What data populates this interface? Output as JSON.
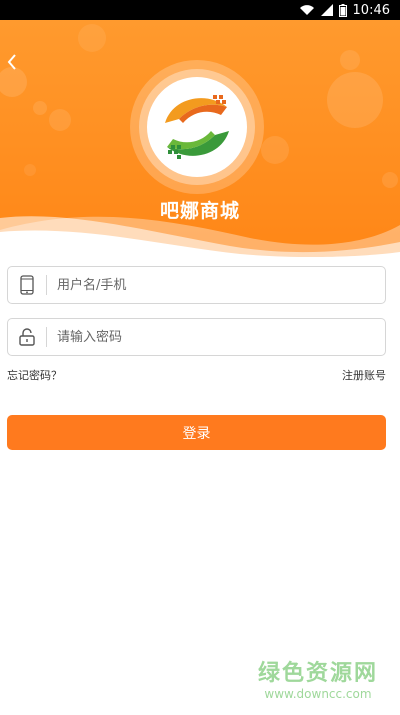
{
  "status_bar": {
    "time": "10:46"
  },
  "header": {
    "app_name": "吧娜商城"
  },
  "login_form": {
    "username_placeholder": "用户名/手机",
    "password_placeholder": "请输入密码",
    "forgot_password": "忘记密码？",
    "register": "注册账号",
    "login_button": "登录"
  },
  "watermark": {
    "brand": "绿色资源网",
    "url": "www.downcc.com"
  },
  "colors": {
    "accent": "#ff7a1e",
    "header_orange": "#ff8a1c",
    "watermark_green": "#9fd89b"
  },
  "icons": [
    "wifi-icon",
    "signal-icon",
    "battery-icon",
    "back-arrow-icon",
    "app-logo",
    "phone-icon",
    "lock-icon"
  ]
}
